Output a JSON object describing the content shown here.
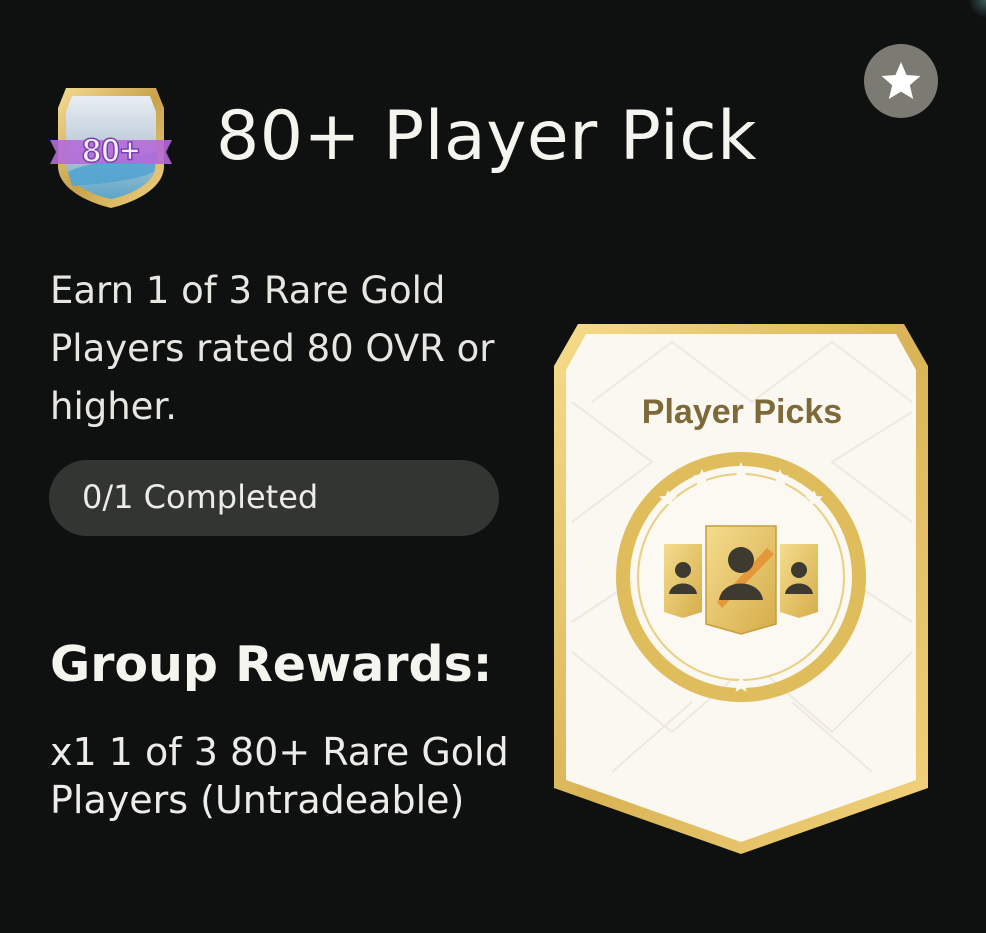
{
  "header": {
    "title": "80+ Player Pick",
    "badge_text": "80+",
    "favorite_icon": "star-icon"
  },
  "objective": {
    "description": "Earn 1 of 3 Rare Gold Players rated 80 OVR or higher.",
    "progress_label": "0/1 Completed"
  },
  "rewards": {
    "heading": "Group Rewards:",
    "items_text": "x1 1 of 3 80+ Rare Gold Players (Untradeable)"
  },
  "pack": {
    "label": "Player Picks",
    "icon": "player-picks-emblem-icon"
  },
  "colors": {
    "background": "#0f1111",
    "pill": "#333533",
    "gold": "#e4c061",
    "pack_label": "#7d6a38",
    "fav_button": "#7b7b73"
  }
}
